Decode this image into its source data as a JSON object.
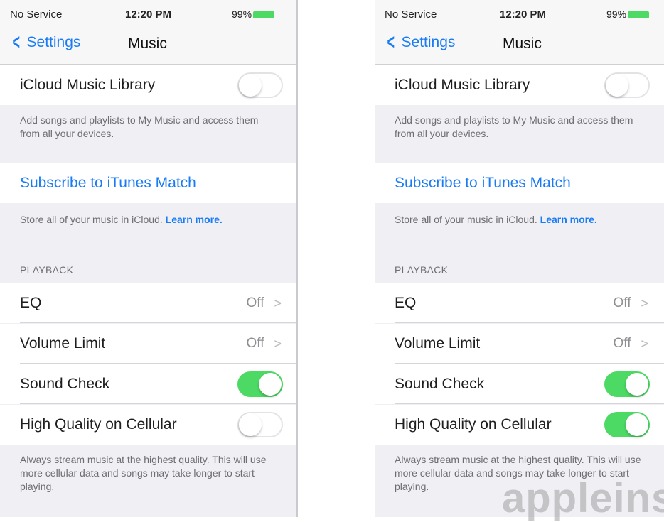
{
  "status": {
    "carrier": "No Service",
    "time": "12:20 PM",
    "battery": "99%"
  },
  "nav": {
    "back_label": "Settings",
    "title": "Music"
  },
  "rows": {
    "icloud_library": "iCloud Music Library",
    "icloud_footer": "Add songs and playlists to My Music and access them from all your devices.",
    "subscribe": "Subscribe to iTunes Match",
    "store_footer": "Store all of your music in iCloud.",
    "learn_more": "Learn more.",
    "playback_header": "PLAYBACK",
    "eq": "EQ",
    "eq_value": "Off",
    "volume_limit": "Volume Limit",
    "volume_limit_value": "Off",
    "sound_check": "Sound Check",
    "high_quality": "High Quality on Cellular",
    "hq_footer": "Always stream music at the highest quality. This will use more cellular data and songs may take longer to start playing."
  },
  "screens": {
    "left": {
      "icloud_library_on": false,
      "sound_check_on": true,
      "high_quality_on": false
    },
    "right": {
      "icloud_library_on": false,
      "sound_check_on": true,
      "high_quality_on": true
    }
  },
  "watermark": "appleins",
  "colors": {
    "accent": "#1a7cf5",
    "switch_on": "#4cd964"
  }
}
